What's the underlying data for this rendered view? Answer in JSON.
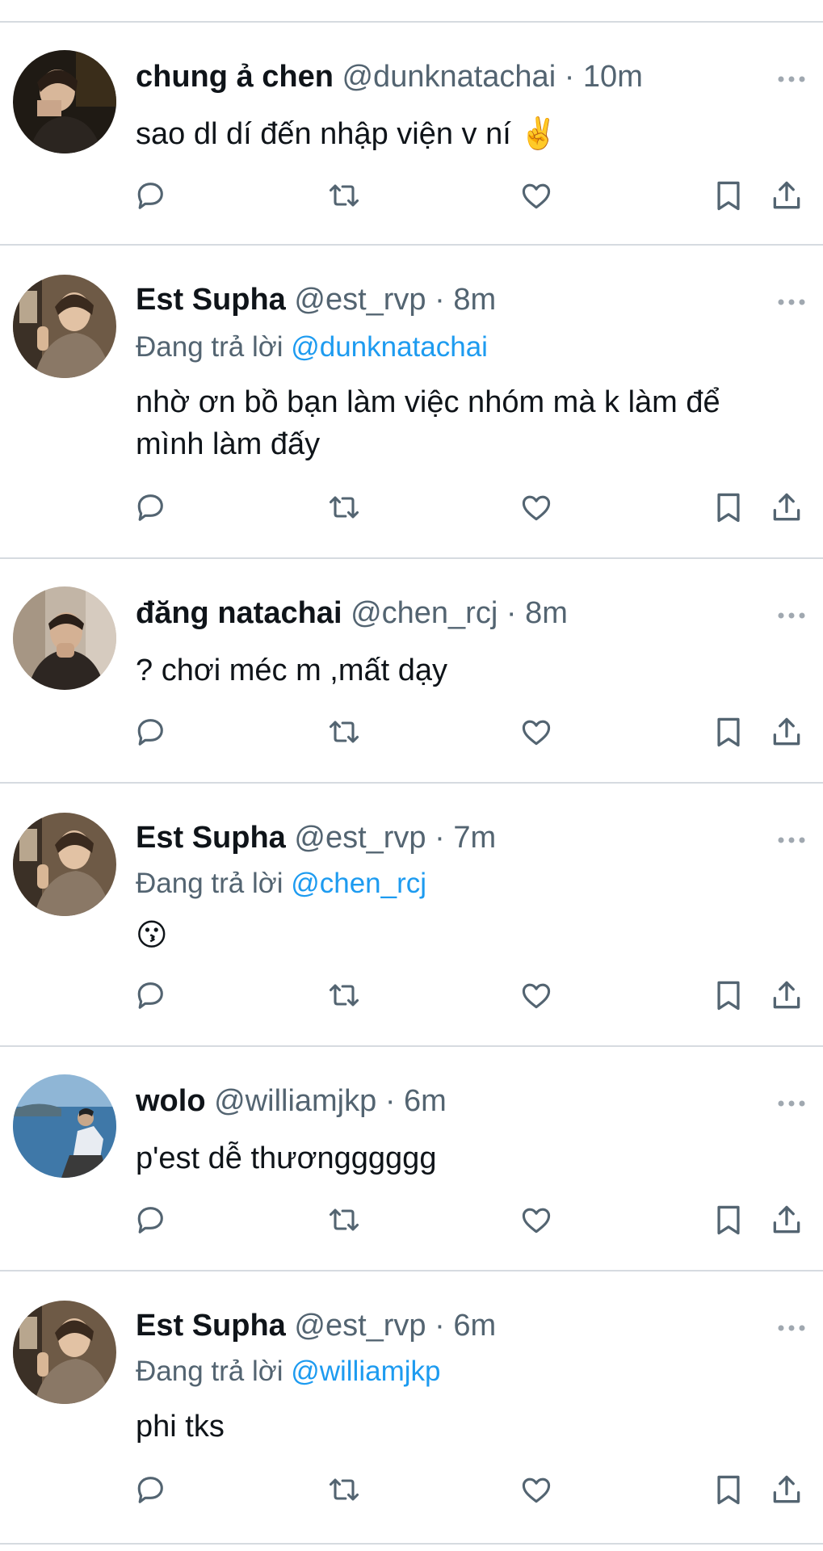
{
  "tweets": [
    {
      "name": "chung ả chen",
      "handle": "@dunknatachai",
      "dot": "·",
      "time": "10m",
      "reply_prefix": "",
      "reply_to": "",
      "text": "sao dl dí đến nhập viện v ní ✌️",
      "avatar": "avatar-chen"
    },
    {
      "name": "Est Supha",
      "handle": "@est_rvp",
      "dot": "·",
      "time": "8m",
      "reply_prefix": "Đang trả lời ",
      "reply_to": "@dunknatachai",
      "text_line1": "nhờ ơn bồ bạn làm việc nhóm mà k làm để",
      "text_line2": "mình làm đấy",
      "avatar": "avatar-est"
    },
    {
      "name": "đăng natachai",
      "handle": "@chen_rcj",
      "dot": "·",
      "time": "8m",
      "reply_prefix": "",
      "reply_to": "",
      "text": "? chơi méc m ,mất dạy",
      "avatar": "avatar-natachai"
    },
    {
      "name": "Est Supha",
      "handle": "@est_rvp",
      "dot": "·",
      "time": "7m",
      "reply_prefix": "Đang trả lời ",
      "reply_to": "@chen_rcj",
      "text": "😗",
      "avatar": "avatar-est"
    },
    {
      "name": "wolo",
      "handle": "@williamjkp",
      "dot": "·",
      "time": "6m",
      "reply_prefix": "",
      "reply_to": "",
      "text": "p'est dễ thươngggggg",
      "avatar": "avatar-wolo"
    },
    {
      "name": "Est Supha",
      "handle": "@est_rvp",
      "dot": "·",
      "time": "6m",
      "reply_prefix": "Đang trả lời ",
      "reply_to": "@williamjkp",
      "text": "phi tks",
      "avatar": "avatar-est"
    }
  ],
  "action_icons": [
    "reply-icon",
    "retweet-icon",
    "like-icon",
    "bookmark-icon",
    "share-icon"
  ],
  "colors": {
    "text": "#0f1419",
    "secondary": "#536471",
    "link": "#1d9bf0",
    "divider": "#d6dbe0"
  }
}
